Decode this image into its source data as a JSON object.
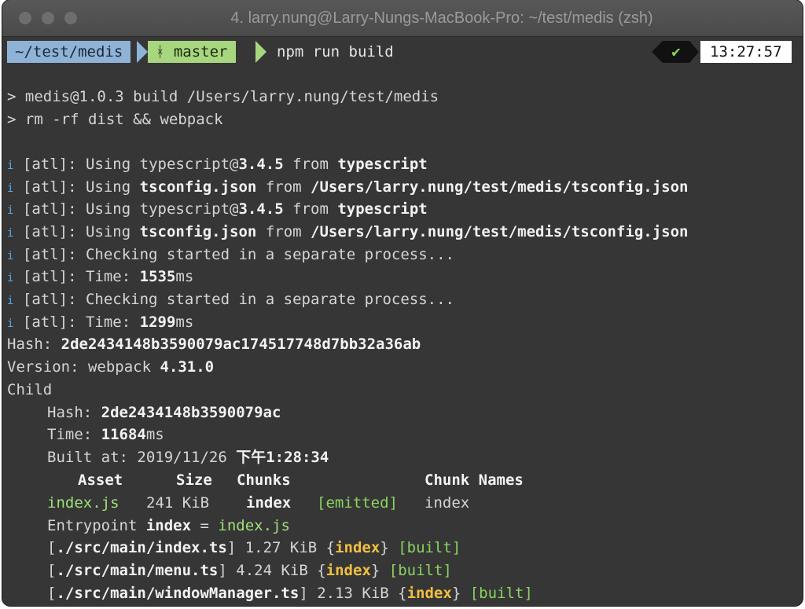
{
  "window": {
    "title": "4. larry.nung@Larry-Nungs-MacBook-Pro: ~/test/medis (zsh)"
  },
  "prompt": {
    "dir": "~/test/medis",
    "branch_icon": "git-branch-icon",
    "branch": "master",
    "command": "npm run build",
    "status_icon": "check-icon",
    "status_glyph": "✔",
    "time": "13:27:57"
  },
  "output": {
    "l1": "> medis@1.0.3 build /Users/larry.nung/test/medis",
    "l2": "> rm -rf dist && webpack",
    "atl_tag": "[atl]",
    "using": "Using",
    "from": "from",
    "ts_pkg_prefix": "typescript@",
    "ts_version": "3.4.5",
    "typescript": "typescript",
    "tsconfig": "tsconfig.json",
    "tsconfig_path": "/Users/larry.nung/test/medis/tsconfig.json",
    "checking": "Checking started in a separate process...",
    "time_label": "Time:",
    "time1": "1535",
    "time2": "1299",
    "ms": "ms",
    "hash_label": "Hash:",
    "hash": "2de2434148b3590079ac174517748d7bb32a36ab",
    "version_label": "Version: webpack",
    "version": "4.31.0",
    "child": "Child",
    "child_hash_label": "Hash:",
    "child_hash": "2de2434148b3590079ac",
    "child_time_label": "Time:",
    "child_time": "11684",
    "built_at_label": "Built at: 2019/11/26",
    "built_at_time": "下午1:28:34",
    "table_header": {
      "asset": "Asset",
      "size": "Size",
      "chunks": "Chunks",
      "chunk_names": "Chunk Names"
    },
    "asset_row": {
      "asset": "index.js",
      "size": "241 KiB",
      "chunks": "index",
      "flag": "[emitted]",
      "name": "index"
    },
    "entrypoint_label": "Entrypoint",
    "entrypoint_name": "index",
    "entrypoint_eq": "=",
    "entrypoint_file": "index.js",
    "modules": [
      {
        "path": "./src/main/index.ts",
        "size": "1.27 KiB",
        "chunk": "index",
        "flag": "[built]"
      },
      {
        "path": "./src/main/menu.ts",
        "size": "4.24 KiB",
        "chunk": "index",
        "flag": "[built]"
      },
      {
        "path": "./src/main/windowManager.ts",
        "size": "2.13 KiB",
        "chunk": "index",
        "flag": "[built]"
      }
    ]
  },
  "colors": {
    "background": "#363636",
    "dir_segment": "#8fb3d6",
    "git_segment": "#a8d67e",
    "green_text": "#8ad45f",
    "yellow_text": "#f0c040",
    "info_icon": "#58a6e6"
  }
}
